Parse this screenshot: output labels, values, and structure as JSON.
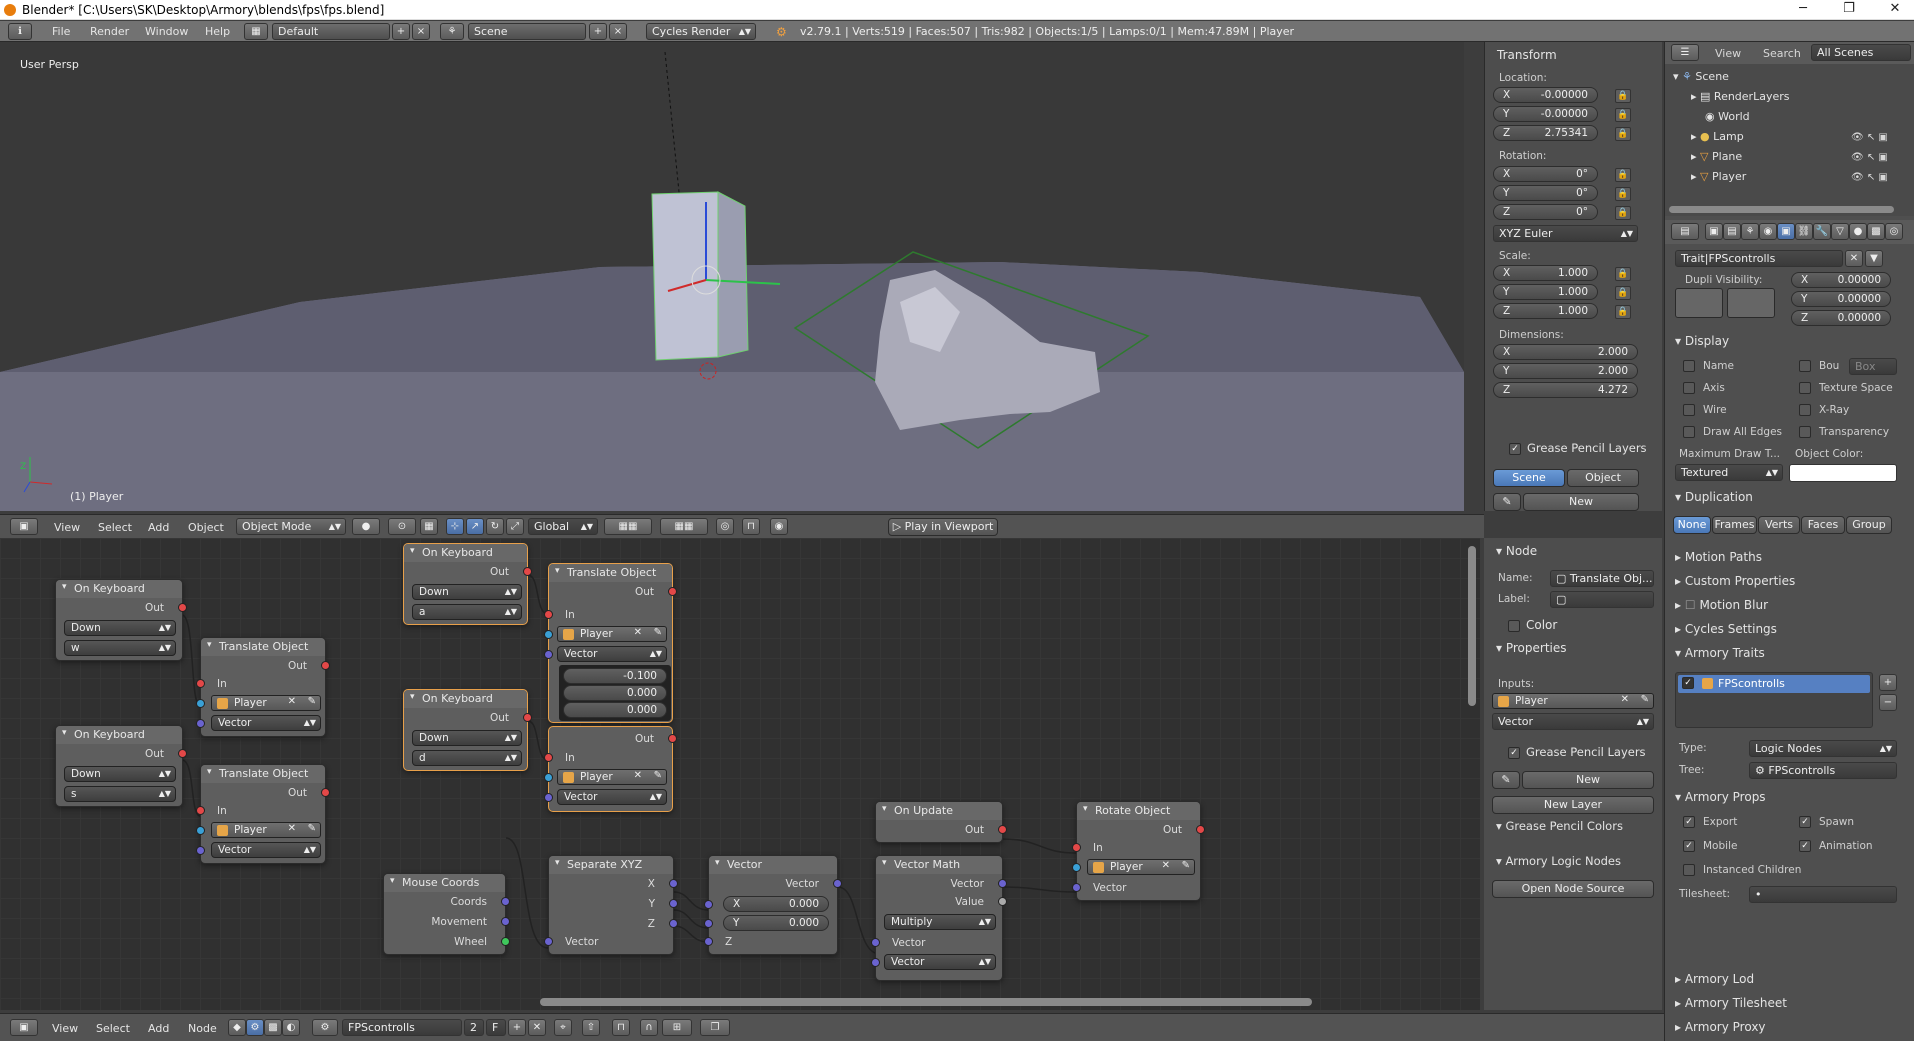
{
  "window": {
    "title": "Blender* [C:\\Users\\SK\\Desktop\\Armory\\blends\\fps\\fps.blend]",
    "min": "─",
    "max": "❐",
    "close": "✕"
  },
  "topbar": {
    "menus": [
      "File",
      "Render",
      "Window",
      "Help"
    ],
    "layout": "Default",
    "scene": "Scene",
    "engine": "Cycles Render",
    "stats": "v2.79.1 | Verts:519 | Faces:507 | Tris:982 | Objects:1/5 | Lamps:0/1 | Mem:47.89M | Player"
  },
  "viewport": {
    "label": "User Persp",
    "object_label": "(1) Player"
  },
  "vp_header": {
    "menus": [
      "View",
      "Select",
      "Add",
      "Object"
    ],
    "mode": "Object Mode",
    "orientation": "Global",
    "play": "Play in Viewport"
  },
  "transform": {
    "title": "Transform",
    "location_label": "Location:",
    "location": {
      "x": "-0.00000",
      "y": "-0.00000",
      "z": "2.75341"
    },
    "rotation_label": "Rotation:",
    "rotation": {
      "x": "0°",
      "y": "0°",
      "z": "0°"
    },
    "euler": "XYZ Euler",
    "scale_label": "Scale:",
    "scale": {
      "x": "1.000",
      "y": "1.000",
      "z": "1.000"
    },
    "dimensions_label": "Dimensions:",
    "dimensions": {
      "x": "2.000",
      "y": "2.000",
      "z": "4.272"
    },
    "gpl": "Grease Pencil Layers",
    "scene_btn": "Scene",
    "object_btn": "Object",
    "new_btn": "New"
  },
  "axes": {
    "x": "X",
    "y": "Y",
    "z": "Z"
  },
  "outliner": {
    "menus": [
      "View",
      "Search"
    ],
    "filter": "All Scenes",
    "items": [
      "Scene",
      "RenderLayers",
      "World",
      "Lamp",
      "Plane",
      "Player"
    ]
  },
  "properties": {
    "trait": "Trait|FPScontrolls",
    "dupli_label": "Dupli Visibility:",
    "dupli": {
      "x": "0.00000",
      "y": "0.00000",
      "z": "0.00000"
    },
    "display": "Display",
    "display_items": [
      "Name",
      "Axis",
      "Wire",
      "Draw All Edges",
      "Bou",
      "Texture Space",
      "X-Ray",
      "Transparency"
    ],
    "bou_val": "Box",
    "max_draw_label": "Maximum Draw T...",
    "object_color_label": "Object Color:",
    "max_draw": "Textured",
    "duplication": "Duplication",
    "dup_tabs": [
      "None",
      "Frames",
      "Verts",
      "Faces",
      "Group"
    ],
    "collapsed": [
      "Motion Paths",
      "Custom Properties",
      "Motion Blur",
      "Cycles Settings"
    ],
    "armory_traits": "Armory Traits",
    "trait_item": "FPScontrolls",
    "type_label": "Type:",
    "type_val": "Logic Nodes",
    "tree_label": "Tree:",
    "tree_val": "FPScontrolls",
    "armory_props": "Armory Props",
    "props_checks": [
      "Export",
      "Spawn",
      "Mobile",
      "Animation"
    ],
    "instanced": "Instanced Children",
    "tilesheet_label": "Tilesheet:",
    "tilesheet_val": "•",
    "bottom": [
      "Armory Lod",
      "Armory Tilesheet",
      "Armory Proxy"
    ]
  },
  "node_panel": {
    "title": "Node",
    "name_label": "Name:",
    "name_val": "Translate Obj...",
    "label_label": "Label:",
    "color": "Color",
    "properties": "Properties",
    "inputs_label": "Inputs:",
    "input_obj": "Player",
    "input_vec": "Vector",
    "gpl": "Grease Pencil Layers",
    "new": "New",
    "new_layer": "New Layer",
    "gpc": "Grease Pencil Colors",
    "aln": "Armory Logic Nodes",
    "open_src": "Open Node Source"
  },
  "ne_header": {
    "menus": [
      "View",
      "Select",
      "Add",
      "Node"
    ],
    "tree": "FPScontrolls",
    "users": "2",
    "fake": "F"
  },
  "nodes": {
    "on_keyboard": "On Keyboard",
    "translate": "Translate Object",
    "out": "Out",
    "in": "In",
    "down": "Down",
    "player": "Player",
    "vector": "Vector",
    "keys": [
      "w",
      "s",
      "a",
      "d"
    ],
    "vec_vals": [
      "-0.100",
      "0.000",
      "0.000"
    ],
    "mouse": "Mouse Coords",
    "coords": "Coords",
    "movement": "Movement",
    "wheel": "Wheel",
    "sep": "Separate XYZ",
    "x": "X",
    "y": "Y",
    "z": "Z",
    "vec_node": "Vector",
    "vx": "0.000",
    "vy": "0.000",
    "vmath": "Vector Math",
    "value": "Value",
    "multiply": "Multiply",
    "on_update": "On Update",
    "rotate": "Rotate Object"
  }
}
